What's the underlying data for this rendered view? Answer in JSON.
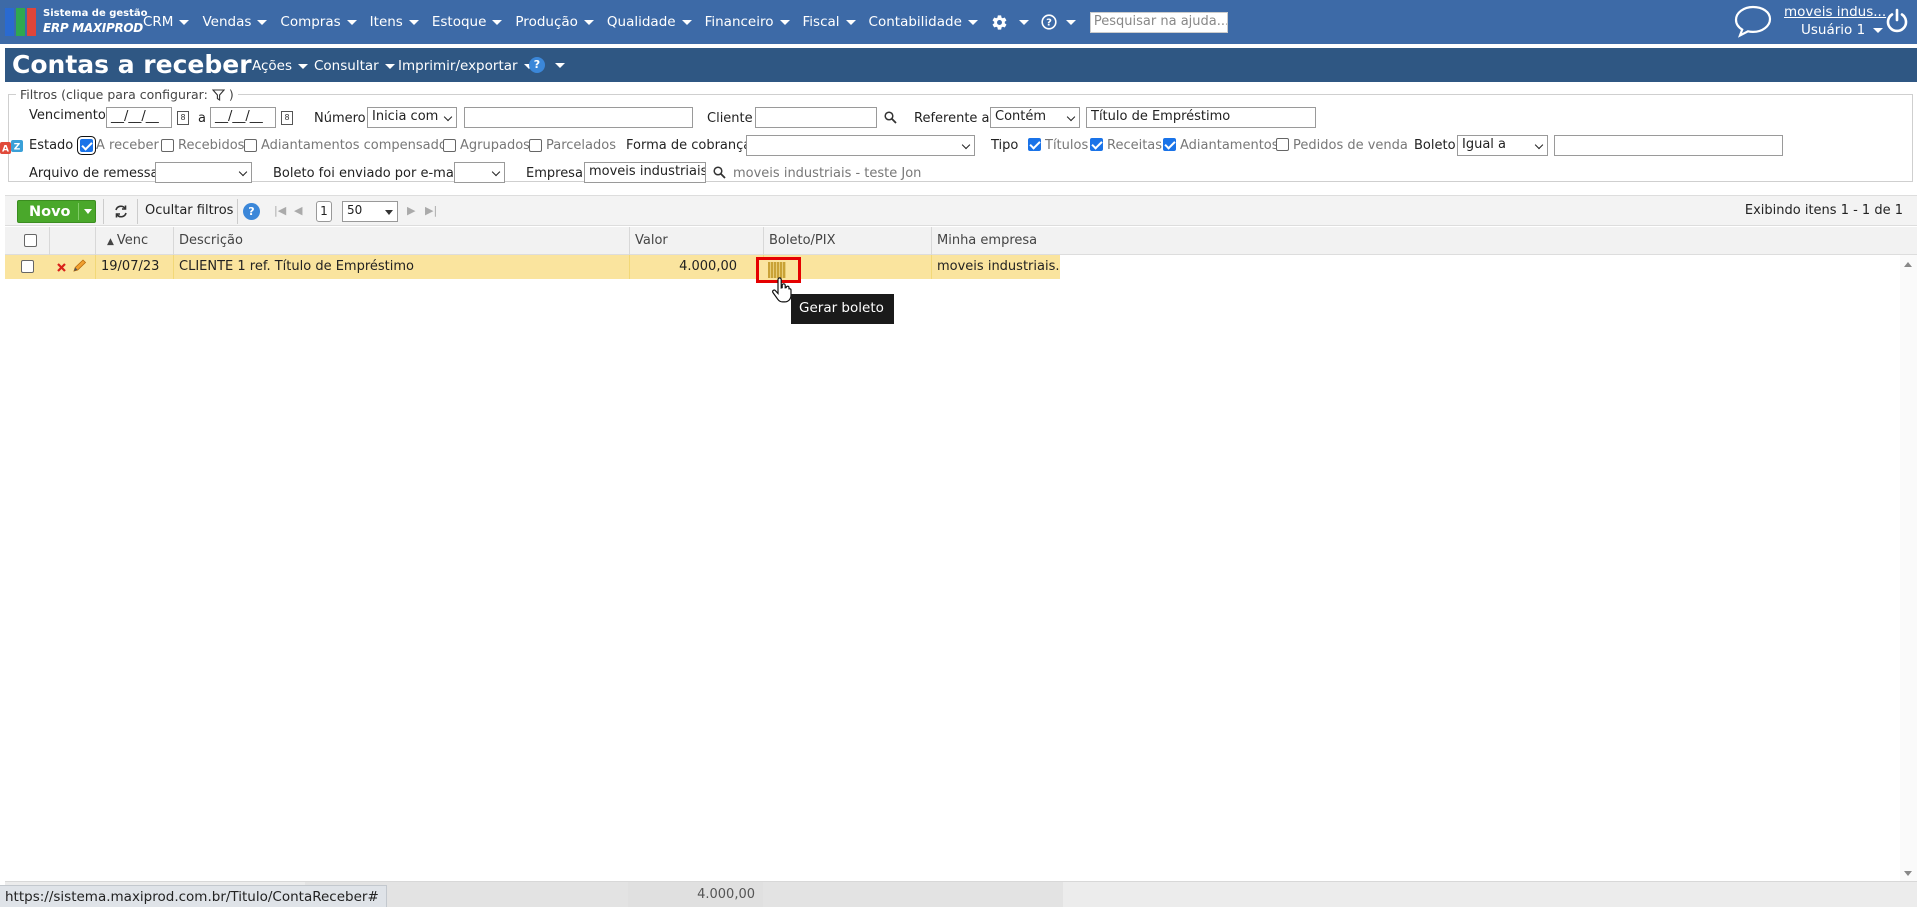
{
  "app": {
    "logo_line1": "Sistema de gestão",
    "logo_line2": "ERP MAXIPROD",
    "nav": [
      "CRM",
      "Vendas",
      "Compras",
      "Itens",
      "Estoque",
      "Produção",
      "Qualidade",
      "Financeiro",
      "Fiscal",
      "Contabilidade"
    ],
    "help_search_placeholder": "Pesquisar na ajuda...",
    "company_link": "moveis indus...",
    "user": "Usuário 1"
  },
  "page": {
    "title": "Contas a receber",
    "menus": [
      "Ações",
      "Consultar",
      "Imprimir/exportar"
    ],
    "help_glyph": "?"
  },
  "filters": {
    "legend": "Filtros (clique para configurar:",
    "legend_close": ")",
    "vencimento_label": "Vencimento",
    "date_from": "__/__/__",
    "date_sep": "a",
    "date_to": "__/__/__",
    "numero_label": "Número",
    "numero_op": "Inicia com",
    "numero_value": "",
    "cliente_label": "Cliente",
    "cliente_value": "",
    "referente_label": "Referente a",
    "referente_op": "Contém",
    "referente_value": "Título de Empréstimo",
    "estado_label": "Estado",
    "estados": [
      {
        "label": "A receber",
        "checked": true
      },
      {
        "label": "Recebidos",
        "checked": false
      },
      {
        "label": "Adiantamentos compensados",
        "checked": false
      },
      {
        "label": "Agrupados",
        "checked": false
      },
      {
        "label": "Parcelados",
        "checked": false
      }
    ],
    "forma_label": "Forma de cobrança",
    "forma_value": "",
    "tipo_label": "Tipo",
    "tipos": [
      {
        "label": "Títulos",
        "checked": true
      },
      {
        "label": "Receitas",
        "checked": true
      },
      {
        "label": "Adiantamentos",
        "checked": true
      },
      {
        "label": "Pedidos de venda",
        "checked": false
      }
    ],
    "boleto_label": "Boleto",
    "boleto_op": "Igual a",
    "boleto_value": "",
    "remessa_label": "Arquivo de remessa",
    "remessa_value": "",
    "email_label": "Boleto foi enviado por e-mail",
    "email_value": "",
    "empresa_label": "Empresa",
    "empresa_value": "moveis industriais - t",
    "empresa_desc": "moveis industriais - teste Jon"
  },
  "toolbar": {
    "novo": "Novo",
    "hide_filters": "Ocultar filtros",
    "page": "1",
    "page_size": "50",
    "display_info": "Exibindo itens 1 - 1 de 1"
  },
  "grid": {
    "columns": [
      "Venc",
      "Descrição",
      "Valor",
      "Boleto/PIX",
      "Minha empresa"
    ],
    "rows": [
      {
        "venc": "19/07/23",
        "descricao": "CLIENTE 1 ref. Título de Empréstimo",
        "valor": "4.000,00",
        "empresa": "moveis industriais..."
      }
    ],
    "total": "4.000,00"
  },
  "tooltip": "Gerar boleto",
  "status_url": "https://sistema.maxiprod.com.br/Titulo/ContaReceber#",
  "colors": {
    "topbar": "#3d6aa7",
    "header": "#2f5783",
    "row_highlight": "#fae49e",
    "novo_button": "#4aa82b",
    "highlight_border": "#e50000"
  }
}
